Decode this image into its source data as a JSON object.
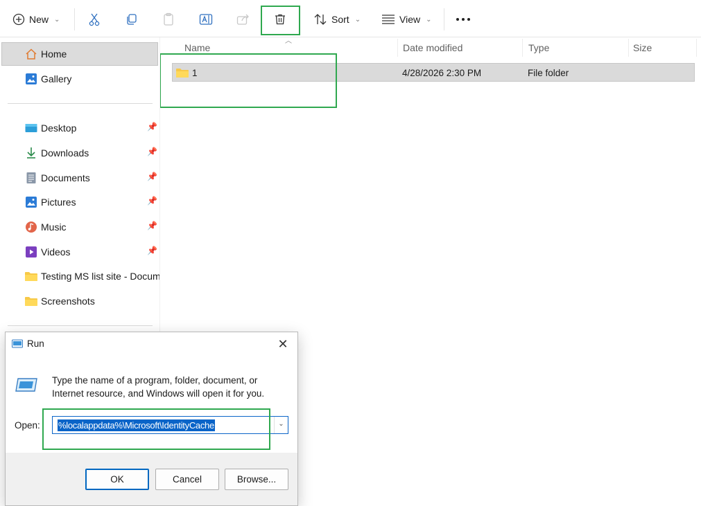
{
  "toolbar": {
    "new_label": "New",
    "sort_label": "Sort",
    "view_label": "View"
  },
  "columns": [
    "Name",
    "Date modified",
    "Type",
    "Size"
  ],
  "rows": [
    {
      "name": "1",
      "date": "4/28/2026 2:30 PM",
      "type": "File folder",
      "size": ""
    }
  ],
  "nav": {
    "home": "Home",
    "gallery": "Gallery",
    "quick": [
      {
        "label": "Desktop",
        "icon": "desktop-icon"
      },
      {
        "label": "Downloads",
        "icon": "download-arrow-icon"
      },
      {
        "label": "Documents",
        "icon": "document-icon"
      },
      {
        "label": "Pictures",
        "icon": "pictures-icon"
      },
      {
        "label": "Music",
        "icon": "music-icon"
      },
      {
        "label": "Videos",
        "icon": "video-icon"
      },
      {
        "label": "Testing MS list site - Docume",
        "icon": "folder-icon"
      },
      {
        "label": "Screenshots",
        "icon": "folder-icon"
      }
    ]
  },
  "run_dialog": {
    "title": "Run",
    "description": "Type the name of a program, folder, document, or Internet resource, and Windows will open it for you.",
    "open_label": "Open:",
    "open_value": "%localappdata%\\Microsoft\\IdentityCache",
    "ok": "OK",
    "cancel": "Cancel",
    "browse": "Browse..."
  },
  "colors": {
    "highlight_box": "#2fa84f",
    "selection": "#dadada",
    "accent": "#0a64c8"
  }
}
